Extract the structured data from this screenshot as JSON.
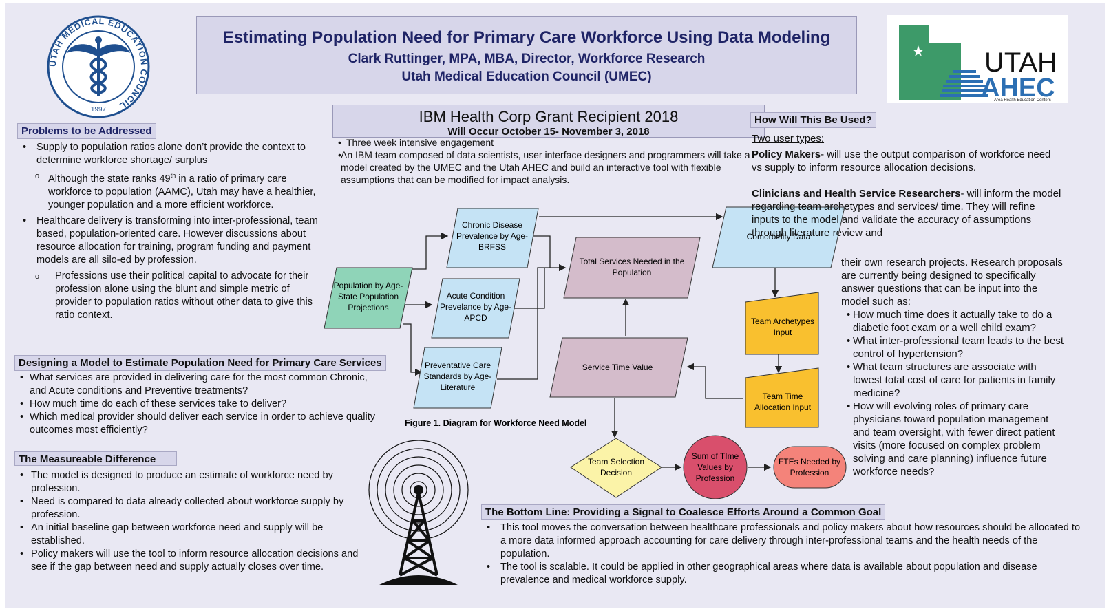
{
  "header": {
    "title": "Estimating Population Need for Primary Care Workforce Using Data Modeling",
    "author": "Clark Ruttinger, MPA, MBA, Director, Workforce Research",
    "org": "Utah Medical Education Council (UMEC)"
  },
  "seal": {
    "ring_text": "UTAH MEDICAL EDUCATION COUNCIL",
    "year": "1997"
  },
  "ahec_logo": {
    "utah": "UTAH",
    "ahec": "AHEC",
    "tag": "Area Health Education Centers"
  },
  "ibm": {
    "title": "IBM Health Corp Grant Recipient 2018",
    "dates": "Will Occur October 15- November 3, 2018",
    "bullets": [
      "Three week intensive engagement",
      "An IBM team composed of data scientists, user interface designers and programmers will take a model created by the UMEC and the Utah AHEC and build an interactive tool with flexible assumptions that can be modified for impact analysis."
    ]
  },
  "problems": {
    "heading": "Problems to be Addressed",
    "b1": "Supply to population ratios alone don’t provide the context to determine workforce shortage/ surplus",
    "s1_pre": "Although the state ranks 49",
    "s1_sup": "th",
    "s1_post": " in a ratio of primary care workforce to population (AAMC), Utah may have a healthier, younger population and a more efficient workforce.",
    "b2": "Healthcare delivery is transforming into inter-professional, team based, population-oriented care. However discussions about resource allocation for training, program funding and payment models are all silo-ed by profession.",
    "s2": "Professions use their political capital to advocate for their profession alone using the blunt and simple metric of provider to population ratios without other data to give this ratio context."
  },
  "designing": {
    "heading": "Designing a Model to Estimate Population Need  for Primary Care Services",
    "bullets": [
      "What services are provided in delivering care for the most common Chronic, and Acute conditions and Preventive treatments?",
      "How much time do each of these services take to deliver?",
      "Which medical provider should deliver each service in order to achieve quality outcomes most efficiently?"
    ]
  },
  "measurable": {
    "heading": "The Measureable Difference",
    "bullets": [
      "The model is designed to produce an estimate of workforce need by profession.",
      "Need is compared to data already collected about workforce supply by profession.",
      "An initial baseline gap between workforce need and supply will be established.",
      "Policy makers will use the tool to inform resource allocation decisions and see if the gap between need and supply actually closes over time."
    ]
  },
  "diagram": {
    "caption": "Figure 1. Diagram for Workforce Need Model",
    "nodes": {
      "population": "Population by Age-|State Population|Projections",
      "chronic": "Chronic Disease|Prevalence by Age-|BRFSS",
      "acute": "Acute Condition|Prevelance by Age-|APCD",
      "preventative": "Preventative Care|Standards by Age-|Literature",
      "total_services": "Total Services Needed in the|Population",
      "comorbidity": "Comorbidity Data",
      "team_archetypes": "Team Archetypes|Input",
      "team_time": "Team Time|Allocation Input",
      "service_time": "Service Time Value",
      "team_selection": "Team Selection|Decision",
      "sum_time": "Sum of TIme|Values by|Profession",
      "ftes": "FTEs Needed by|Profession"
    },
    "colors": {
      "green": "#8fd4b8",
      "blue": "#c5e3f5",
      "purple": "#d4bccb",
      "orange": "#f9c02f",
      "yellow": "#fbf3a8",
      "crimson": "#d94f6c",
      "salmon": "#f4837a"
    }
  },
  "how_used": {
    "heading": "How Will This Be Used?",
    "two_types": "Two user types:",
    "policy_bold": "Policy Makers",
    "policy_text": "- will use the output comparison of workforce need vs supply to inform resource allocation decisions.",
    "clin_bold": "Clinicians and Health Service Researchers",
    "clin_text_1": "- will inform the model regarding team archetypes and services/ time. They will  refine inputs to the model and validate the accuracy of assumptions through literature review and",
    "clin_text_2": "their own research projects. Research proposals are currently being designed to specifically answer questions that can be input into the model such as:",
    "questions": [
      "How much time does it actually take to do a diabetic foot exam or a well child exam?",
      "What inter-professional team leads to the best control of hypertension?",
      "What team structures are associate with lowest total cost of care for patients in family medicine?",
      "How will evolving roles of primary care physicians toward population management and team oversight, with fewer direct patient visits (more focused on complex problem solving and care planning) influence future workforce needs?"
    ]
  },
  "bottom_line": {
    "heading": "The Bottom Line: Providing a Signal to Coalesce Efforts Around a Common Goal",
    "bullets": [
      "This tool moves the conversation between healthcare professionals and policy makers about how resources should be allocated to a more data informed approach accounting for care delivery through inter-professional teams and the health needs of the population.",
      "The tool is scalable. It could be applied in other geographical areas where data is available about population and disease prevalence and medical workforce supply."
    ]
  }
}
